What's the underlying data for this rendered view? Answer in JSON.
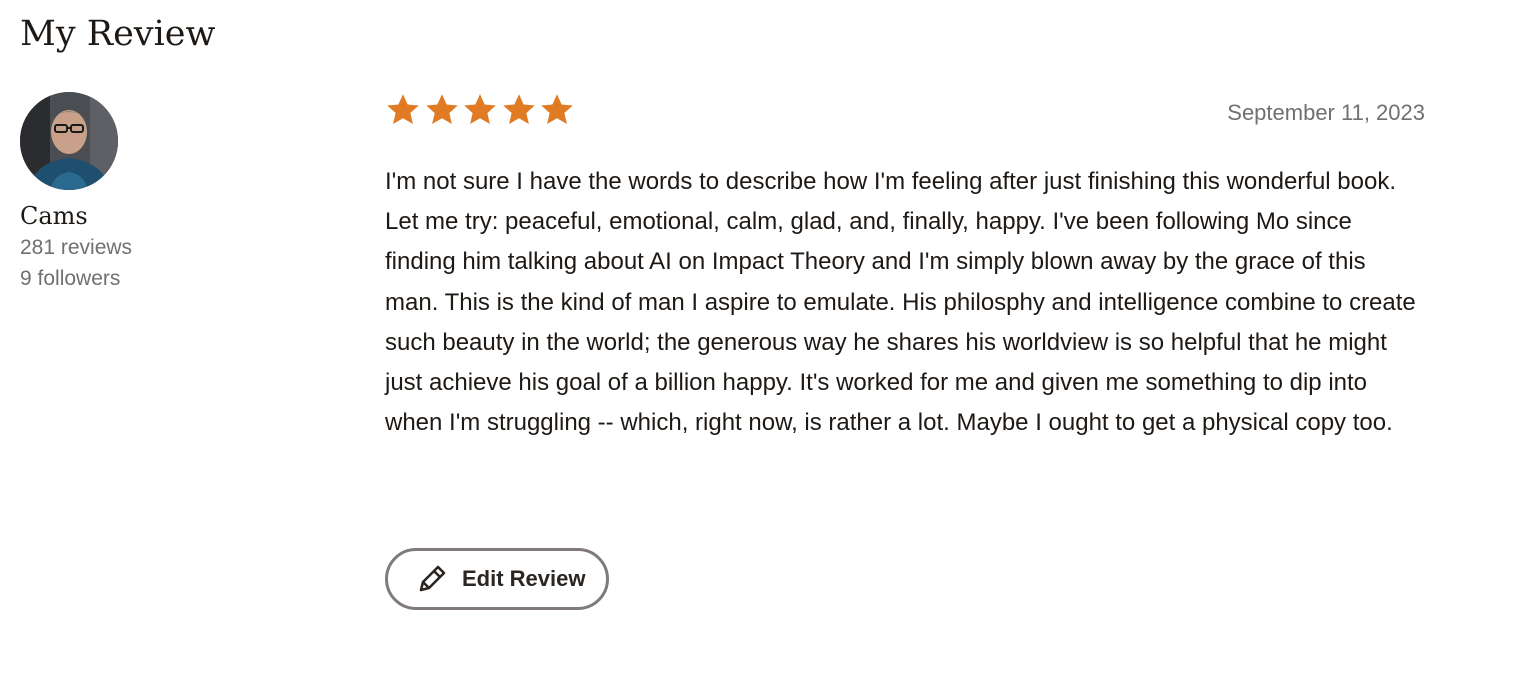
{
  "section": {
    "title": "My Review"
  },
  "reviewer": {
    "name": "Cams",
    "reviews_count": "281 reviews",
    "followers_count": "9 followers"
  },
  "review": {
    "rating": 5,
    "rating_max": 5,
    "star_color": "#e07b24",
    "date": "September 11, 2023",
    "text": "I'm not sure I have the words to describe how I'm feeling after just finishing this wonderful book. Let me try: peaceful, emotional, calm, glad, and, finally, happy. I've been following Mo since finding him talking about AI on Impact Theory and I'm simply blown away by the grace of this man. This is the kind of man I aspire to emulate. His philosphy and intelligence combine to create such beauty in the world; the generous way he shares his worldview is so helpful that he might just achieve his goal of a billion happy. It's worked for me and given me something to dip into when I'm struggling -- which, right now, is rather a lot. Maybe I ought to get a physical copy too."
  },
  "actions": {
    "edit_label": "Edit Review",
    "edit_icon": "pencil-icon"
  }
}
